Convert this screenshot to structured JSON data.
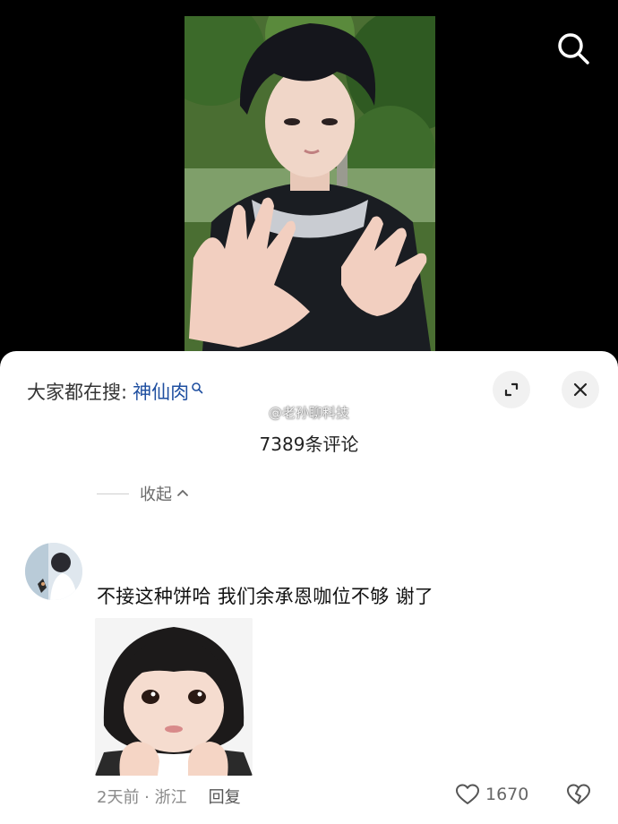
{
  "video": {
    "search_icon": "search-icon"
  },
  "sheet": {
    "hot_prefix": "大家都在搜:",
    "hot_keyword": "神仙肉",
    "expand_icon": "expand-icon",
    "close_icon": "close-icon",
    "watermark": "@老孙聊科技",
    "comment_count": "7389条评论",
    "collapse_label": "收起"
  },
  "comment": {
    "username": "",
    "text": "不接这种饼哈 我们余承恩咖位不够 谢了",
    "time_location": "2天前 · 浙江",
    "reply_label": "回复",
    "like_count": "1670"
  },
  "colors": {
    "keyword": "#1f4fa0",
    "sheet_bg": "#ffffff",
    "page_bg": "#000000"
  }
}
